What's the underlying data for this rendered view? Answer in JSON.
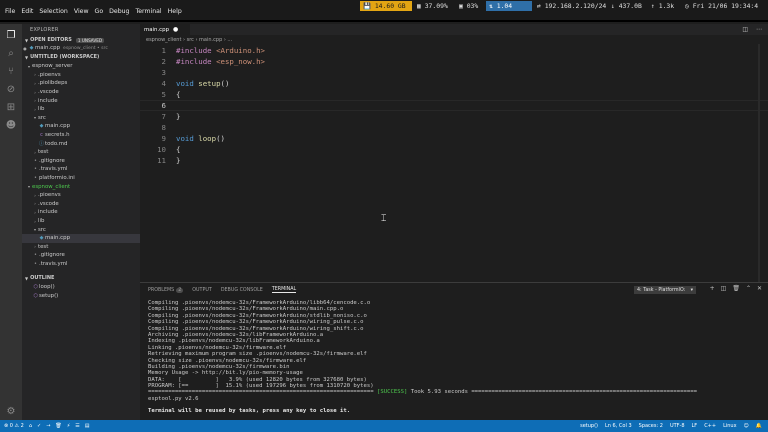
{
  "topbar": {
    "menu": [
      "File",
      "Edit",
      "Selection",
      "View",
      "Go",
      "Debug",
      "Terminal",
      "Help"
    ],
    "disk": "14.60 GB",
    "cpu": "37.09%",
    "mem": "03%",
    "net": "1.04",
    "ip": "192.168.2.120/24",
    "download": "437.0B",
    "upload": "1.3k",
    "clock": "Fri 21/06 19:34:4"
  },
  "sidebar": {
    "title": "EXPLORER",
    "open_editors": {
      "label": "OPEN EDITORS",
      "badge": "1 UNSAVED",
      "file": "main.cpp",
      "path": "espnow_client • src"
    },
    "workspace_label": "UNTITLED (WORKSPACE)",
    "tree": [
      {
        "label": "espnow_server",
        "type": "root"
      },
      {
        "label": ".pioenvs",
        "type": "folder"
      },
      {
        "label": ".piolibdeps",
        "type": "folder"
      },
      {
        "label": ".vscode",
        "type": "folder"
      },
      {
        "label": "include",
        "type": "folder"
      },
      {
        "label": "lib",
        "type": "folder"
      },
      {
        "label": "src",
        "type": "folder-open"
      },
      {
        "label": "main.cpp",
        "type": "file-cpp"
      },
      {
        "label": "secrets.h",
        "type": "file-h"
      },
      {
        "label": "todo.md",
        "type": "file-md"
      },
      {
        "label": "test",
        "type": "folder"
      },
      {
        "label": ".gitignore",
        "type": "file"
      },
      {
        "label": ".travis.yml",
        "type": "file"
      },
      {
        "label": "platformio.ini",
        "type": "file"
      },
      {
        "label": "espnow_client",
        "type": "root-active"
      },
      {
        "label": ".pioenvs",
        "type": "folder"
      },
      {
        "label": ".vscode",
        "type": "folder"
      },
      {
        "label": "include",
        "type": "folder"
      },
      {
        "label": "lib",
        "type": "folder"
      },
      {
        "label": "src",
        "type": "folder-open"
      },
      {
        "label": "main.cpp",
        "type": "file-cpp-selected"
      },
      {
        "label": "test",
        "type": "folder"
      },
      {
        "label": ".gitignore",
        "type": "file"
      },
      {
        "label": ".travis.yml",
        "type": "file"
      }
    ],
    "outline_label": "OUTLINE",
    "outline": [
      "loop()",
      "setup()"
    ]
  },
  "editor": {
    "tab": "main.cpp",
    "breadcrumb": "espnow_client › src › main.cpp › ...",
    "line_numbers": [
      "1",
      "2",
      "3",
      "4",
      "5",
      "6",
      "7",
      "8",
      "9",
      "10",
      "11"
    ]
  },
  "panel": {
    "tabs": [
      "PROBLEMS",
      "OUTPUT",
      "DEBUG CONSOLE",
      "TERMINAL"
    ],
    "problems_count": "2",
    "task": "4: Task - PlatformIO:",
    "lines": [
      "Compiling .pioenvs/nodemcu-32s/FrameworkArduino/libb64/cencode.c.o",
      "Compiling .pioenvs/nodemcu-32s/FrameworkArduino/main.cpp.o",
      "Compiling .pioenvs/nodemcu-32s/FrameworkArduino/stdlib_noniso.c.o",
      "Compiling .pioenvs/nodemcu-32s/FrameworkArduino/wiring_pulse.c.o",
      "Compiling .pioenvs/nodemcu-32s/FrameworkArduino/wiring_shift.c.o",
      "Archiving .pioenvs/nodemcu-32s/libFrameworkArduino.a",
      "Indexing .pioenvs/nodemcu-32s/libFrameworkArduino.a",
      "Linking .pioenvs/nodemcu-32s/firmware.elf",
      "Retrieving maximum program size .pioenvs/nodemcu-32s/firmware.elf",
      "Checking size .pioenvs/nodemcu-32s/firmware.elf",
      "Building .pioenvs/nodemcu-32s/firmware.bin",
      "Memory Usage -> http://bit.ly/pio-memory-usage",
      "DATA:    [          ]   3.9% (used 12820 bytes from 327680 bytes)",
      "PROGRAM: [==        ]  15.1% (used 197296 bytes from 1310720 bytes)",
      "esptool.py v2.6"
    ],
    "success_prefix": "=================================================================== ",
    "success_tag": "[SUCCESS]",
    "success_suffix": " Took 5.93 seconds ===================================================================",
    "final": "Terminal will be reused by tasks, press any key to close it."
  },
  "statusbar": {
    "left": [
      "⊗ 0 ⚠ 2",
      "⌂",
      "✓",
      "→",
      "🗑",
      "⚡",
      "☰",
      "▤"
    ],
    "right": [
      "setup()",
      "Ln 6, Col 3",
      "Spaces: 2",
      "UTF-8",
      "LF",
      "C++",
      "Linux",
      "☺",
      "🔔"
    ]
  },
  "colors": {
    "accent": "#0e6db6",
    "disk_bg": "#e3a513",
    "net_bg": "#2f6fa8"
  }
}
